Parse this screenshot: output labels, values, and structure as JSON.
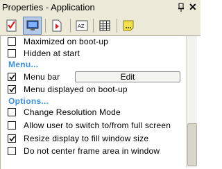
{
  "window": {
    "title": "Properties - Application",
    "close_glyph": "✕"
  },
  "toolbar": {
    "buttons": [
      {
        "icon": "checklist-icon"
      },
      {
        "icon": "monitor-icon",
        "active": true
      },
      {
        "icon": "document-play-icon"
      },
      {
        "icon": "az-sort-icon"
      },
      {
        "icon": "table-grid-icon"
      },
      {
        "icon": "note-icon"
      }
    ]
  },
  "options": {
    "maximized": {
      "label": "Maximized on boot-up",
      "checked": false
    },
    "hidden": {
      "label": "Hidden at start",
      "checked": false
    },
    "menu_header": "Menu...",
    "menu_bar": {
      "label": "Menu bar",
      "checked": true,
      "button": "Edit"
    },
    "menu_boot": {
      "label": "Menu displayed on boot-up",
      "checked": true
    },
    "options_header": "Options...",
    "change_res": {
      "label": "Change Resolution Mode",
      "checked": false
    },
    "allow_switch": {
      "label": "Allow user to switch to/from full screen",
      "checked": false
    },
    "resize_display": {
      "label": "Resize display to fill window size",
      "checked": true
    },
    "no_center": {
      "label": "Do not center frame area in window",
      "checked": false
    }
  },
  "colors": {
    "section_header": "#3d8fe0",
    "toolbar_bg": "#ece9d8",
    "active_button": "#b7c9e8"
  }
}
